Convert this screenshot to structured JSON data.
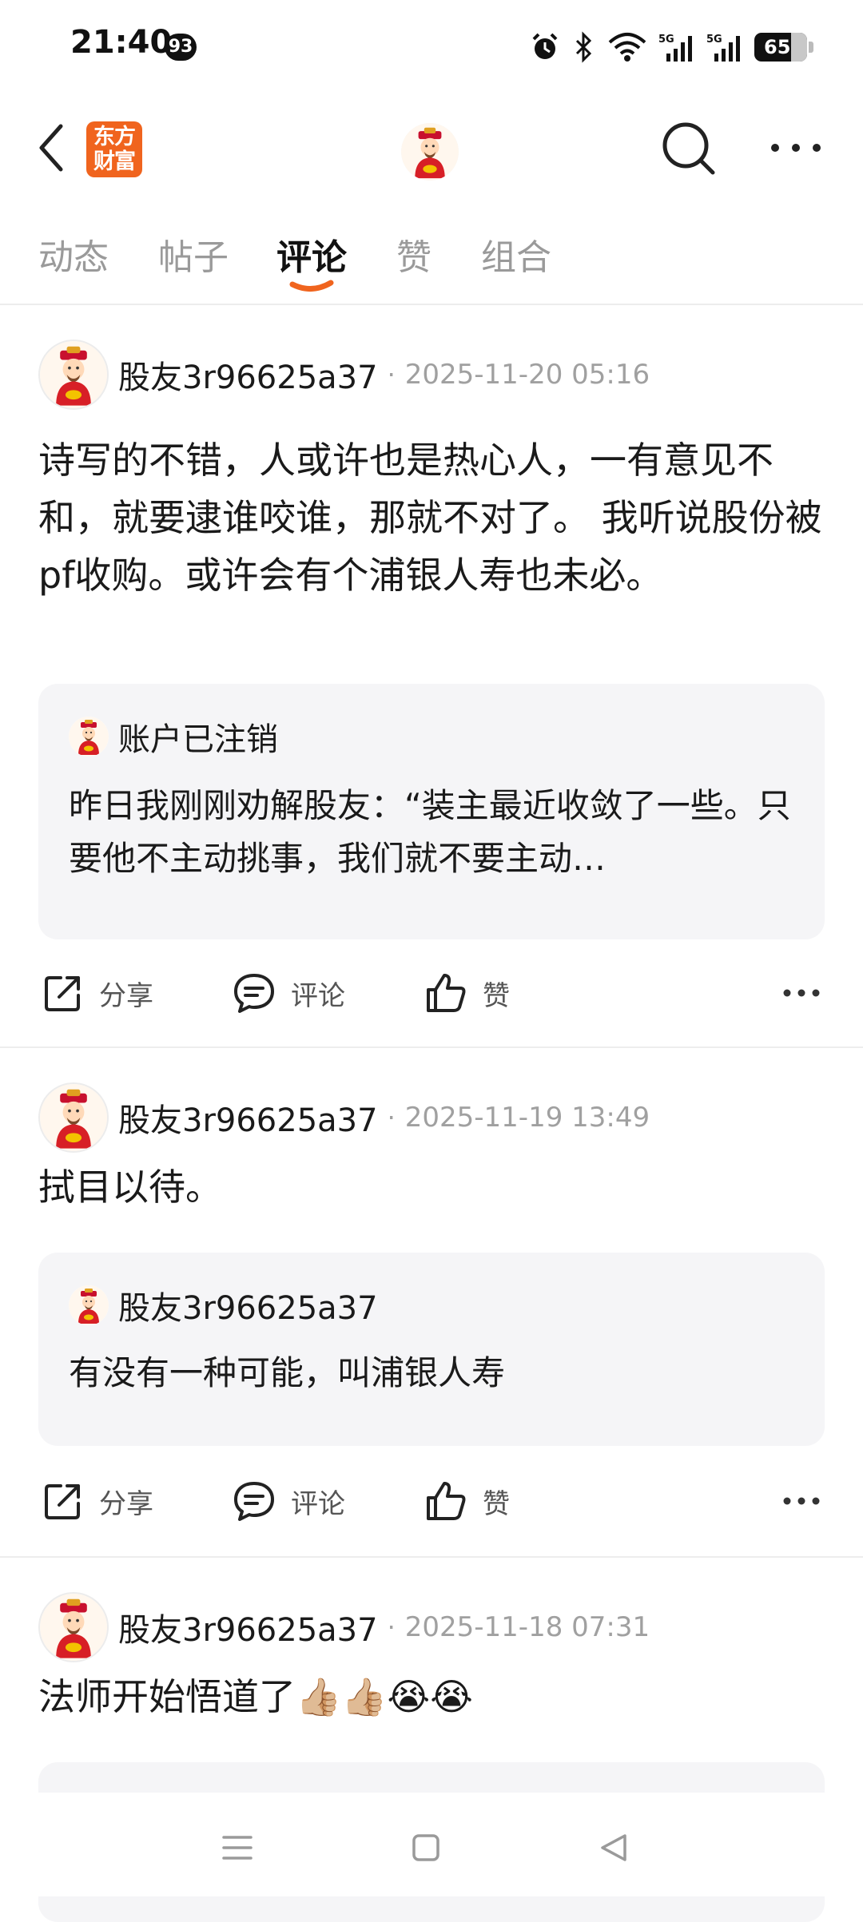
{
  "status_bar": {
    "time": "21:40",
    "notification_count": "93",
    "battery": "65"
  },
  "header": {
    "logo_text": "东方\n财富"
  },
  "tabs": [
    {
      "label": "动态",
      "active": false
    },
    {
      "label": "帖子",
      "active": false
    },
    {
      "label": "评论",
      "active": true
    },
    {
      "label": "赞",
      "active": false
    },
    {
      "label": "组合",
      "active": false
    }
  ],
  "posts": [
    {
      "author": "股友3r96625a37",
      "time": "2025-11-20 05:16",
      "body": "诗写的不错，人或许也是热心人，一有意见不和，就要逮谁咬谁，那就不对了。 我听说股份被pf收购。或许会有个浦银人寿也未必。",
      "quote": {
        "author": "账户已注销",
        "text": "昨日我刚刚劝解股友：“装主最近收敛了一些。只要他不主动挑事，我们就不要主动…"
      }
    },
    {
      "author": "股友3r96625a37",
      "time": "2025-11-19 13:49",
      "body": "拭目以待。",
      "quote": {
        "author": "股友3r96625a37",
        "text": "有没有一种可能，叫浦银人寿"
      }
    },
    {
      "author": "股友3r96625a37",
      "time": "2025-11-18 07:31",
      "body": "法师开始悟道了👍🏼👍🏼😭😭"
    }
  ],
  "actions": {
    "share": "分享",
    "comment": "评论",
    "like": "赞"
  },
  "colors": {
    "brand": "#f0641e",
    "accent_underline": "#f0641e",
    "quote_bg": "#f5f5f7",
    "muted_text": "#a0a0a0"
  },
  "icons": [
    "back-arrow-icon",
    "search-icon",
    "more-icon",
    "share-icon",
    "comment-icon",
    "thumbs-up-icon",
    "menu-icon",
    "home-icon",
    "back-triangle-icon"
  ]
}
